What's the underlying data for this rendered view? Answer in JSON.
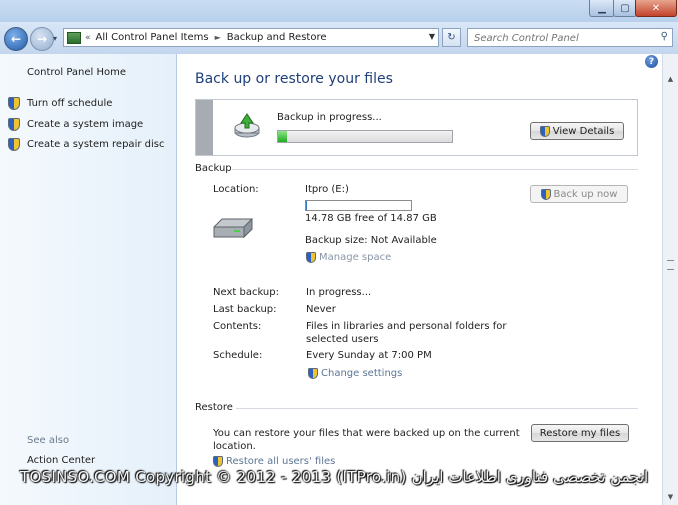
{
  "address": {
    "crumbs": [
      "All Control Panel Items",
      "Backup and Restore"
    ],
    "search_placeholder": "Search Control Panel"
  },
  "left_pane": {
    "home": "Control Panel Home",
    "tasks": [
      "Turn off schedule",
      "Create a system image",
      "Create a system repair disc"
    ],
    "see_also": "See also",
    "see_also_items": [
      "Action Center"
    ]
  },
  "main": {
    "title": "Back up or restore your files",
    "status": "Backup in progress...",
    "progress": 0.05,
    "view_details": "View Details",
    "backup_header": "Backup",
    "location_label": "Location:",
    "location_value": "Itpro (E:)",
    "drive_used_fraction": 0.01,
    "free_space": "14.78 GB free of 14.87 GB",
    "backup_size": "Backup size: Not Available",
    "manage_space": "Manage space",
    "back_up_now": "Back up now",
    "next_backup_label": "Next backup:",
    "next_backup_value": "In progress...",
    "last_backup_label": "Last backup:",
    "last_backup_value": "Never",
    "contents_label": "Contents:",
    "contents_value_1": "Files in libraries and personal folders for",
    "contents_value_2": "selected users",
    "schedule_label": "Schedule:",
    "schedule_value": "Every Sunday at 7:00 PM",
    "change_settings": "Change settings",
    "restore_header": "Restore",
    "restore_text_1": "You can restore your files that were backed up on the current",
    "restore_text_2": "location.",
    "restore_all_users": "Restore all users' files",
    "restore_my_files": "Restore my files"
  },
  "watermark": "TOSINSO.COM Copyright © 2012 - 2013 (ITPro.in) انجمن تخصصی فناوری اطلاعات ایران"
}
